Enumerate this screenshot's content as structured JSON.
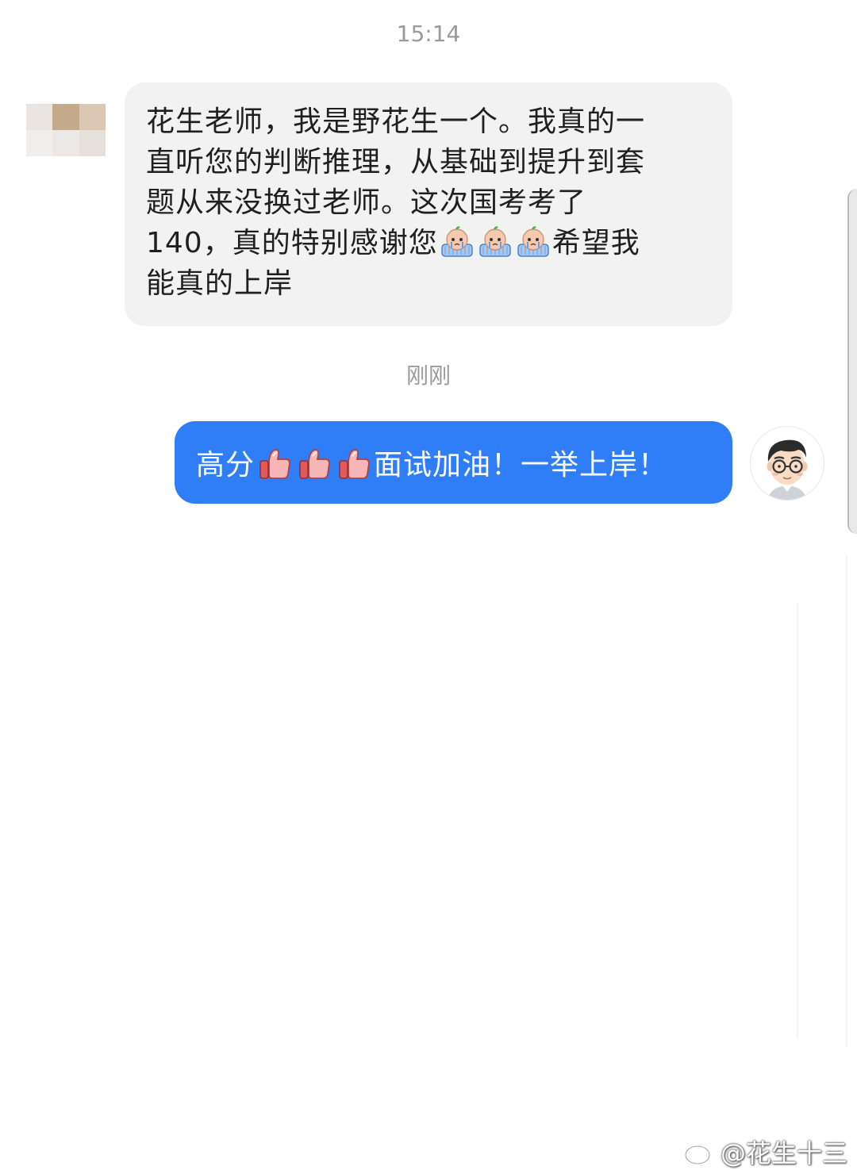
{
  "timestamps": {
    "top": "15:14",
    "middle": "刚刚"
  },
  "incoming_message": {
    "lines": [
      "花生老师，我是野花生一个。我真的一",
      "直听您的判断推理，从基础到提升到套",
      "题从来没换过老师。这次国考考了",
      "140，真的特别感谢您",
      "能真的上岸"
    ],
    "line4_suffix": "希望我",
    "emojis": [
      "crying-emoji",
      "crying-emoji",
      "crying-emoji"
    ],
    "avatar": "pixelated-avatar"
  },
  "outgoing_message": {
    "prefix": "高分",
    "suffix": "面试加油！一举上岸！",
    "emojis": [
      "thumbs-up-emoji",
      "thumbs-up-emoji",
      "thumbs-up-emoji"
    ],
    "avatar": "cartoon-man-avatar"
  },
  "colors": {
    "outgoing_bubble": "#2f7ef8",
    "incoming_bubble": "#f2f2f2",
    "timestamp_text": "#9a9a9a"
  },
  "watermark": {
    "handle": "@花生十三",
    "icon": "weibo-icon"
  }
}
